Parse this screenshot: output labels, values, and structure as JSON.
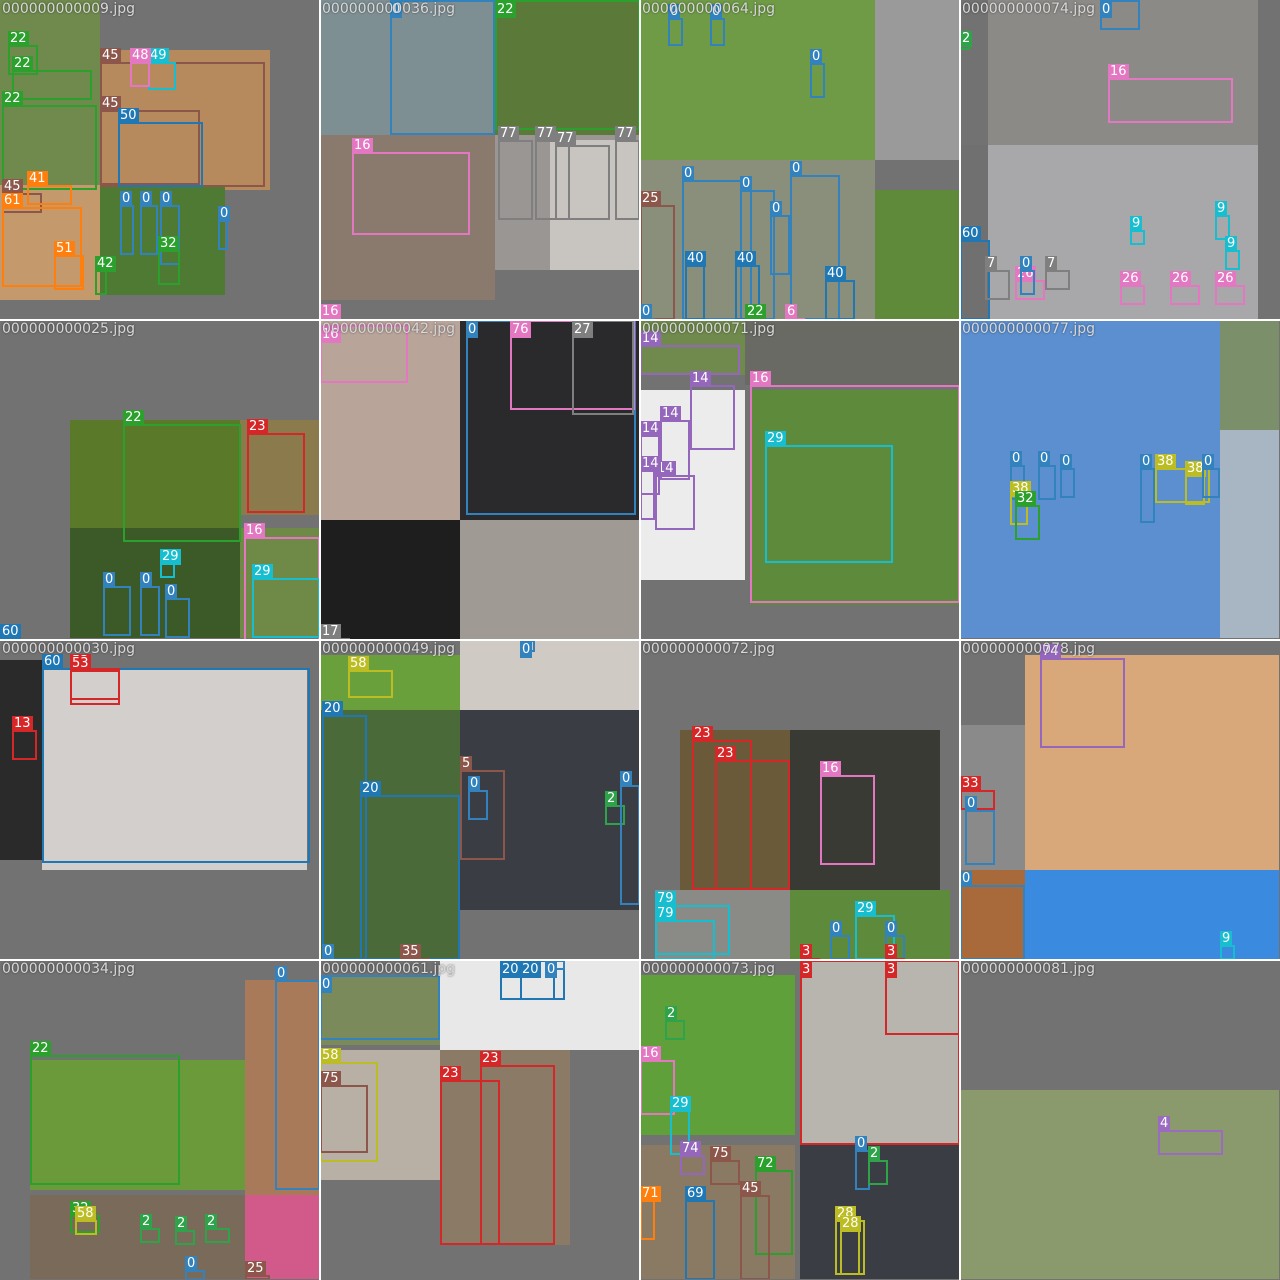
{
  "title": "",
  "class_colors": {
    "0": "#3283bd",
    "2": "#2ea34a",
    "3": "#d62728",
    "4": "#9b6bc2",
    "5": "#8c564b",
    "6": "#e377c2",
    "7": "#7f7f7f",
    "9": "#17becf",
    "13": "#d62728",
    "14": "#9467bd",
    "16": "#e377c2",
    "17": "#7f7f7f",
    "20": "#1f77b4",
    "22": "#2ca02c",
    "23": "#d62728",
    "25": "#8c564b",
    "26": "#e377c2",
    "27": "#7f7f7f",
    "28": "#bcbd22",
    "29": "#17becf",
    "32": "#2ca02c",
    "33": "#d62728",
    "35": "#8c564b",
    "38": "#bcbd22",
    "40": "#1f77b4",
    "41": "#ff7f0e",
    "42": "#2ca02c",
    "45": "#8c564b",
    "48": "#e377c2",
    "49": "#17becf",
    "50": "#1f77b4",
    "51": "#ff7f0e",
    "53": "#d62728",
    "58": "#bcbd22",
    "60": "#1f77b4",
    "61": "#ff7f0e",
    "69": "#1f77b4",
    "71": "#ff7f0e",
    "72": "#2ca02c",
    "74": "#9467bd",
    "75": "#8c564b",
    "76": "#e377c2",
    "77": "#7f7f7f",
    "79": "#17becf"
  },
  "tiles": [
    {
      "name": "000000000009.jpg",
      "photos": [
        {
          "color": "#6f8a4c"
        },
        {
          "color": "#b68a5c"
        },
        {
          "color": "#c49a6c"
        },
        {
          "color": "#4e7a34"
        }
      ],
      "boxes": [
        {
          "cls": "22"
        },
        {
          "cls": "22"
        },
        {
          "cls": "22"
        },
        {
          "cls": "45"
        },
        {
          "cls": "49"
        },
        {
          "cls": "48"
        },
        {
          "cls": "45"
        },
        {
          "cls": "50"
        },
        {
          "cls": "45"
        },
        {
          "cls": "41"
        },
        {
          "cls": "61"
        },
        {
          "cls": "51"
        },
        {
          "cls": "0"
        },
        {
          "cls": "0"
        },
        {
          "cls": "0"
        },
        {
          "cls": "32"
        },
        {
          "cls": "42"
        },
        {
          "cls": "0"
        }
      ]
    },
    {
      "name": "000000000036.jpg",
      "photos": [
        {
          "color": "#7e8f94"
        },
        {
          "color": "#5b7a3a"
        },
        {
          "color": "#8a7a6e"
        },
        {
          "color": "#9a9694"
        },
        {
          "color": "#c8c4c0"
        }
      ],
      "boxes": [
        {
          "cls": "0"
        },
        {
          "cls": "22"
        },
        {
          "cls": "16"
        },
        {
          "cls": "77"
        },
        {
          "cls": "77"
        },
        {
          "cls": "77"
        },
        {
          "cls": "77"
        },
        {
          "cls": "16"
        }
      ]
    },
    {
      "name": "000000000064.jpg",
      "photos": [
        {
          "color": "#6f9b47"
        },
        {
          "color": "#9a9a9a"
        },
        {
          "color": "#8a8f7c"
        },
        {
          "color": "#5f8a3a"
        }
      ],
      "boxes": [
        {
          "cls": "0"
        },
        {
          "cls": "0"
        },
        {
          "cls": "0"
        },
        {
          "cls": "25"
        },
        {
          "cls": "0"
        },
        {
          "cls": "0"
        },
        {
          "cls": "0"
        },
        {
          "cls": "0"
        },
        {
          "cls": "40"
        },
        {
          "cls": "40"
        },
        {
          "cls": "40"
        },
        {
          "cls": "22"
        },
        {
          "cls": "6"
        },
        {
          "cls": "0"
        }
      ]
    },
    {
      "name": "000000000074.jpg",
      "photos": [
        {
          "color": "#8c8a86"
        },
        {
          "color": "#a8a8aa"
        },
        {
          "color": "#707070"
        }
      ],
      "boxes": [
        {
          "cls": "2"
        },
        {
          "cls": "16"
        },
        {
          "cls": "0"
        },
        {
          "cls": "60"
        },
        {
          "cls": "7"
        },
        {
          "cls": "7"
        },
        {
          "cls": "9"
        },
        {
          "cls": "9"
        },
        {
          "cls": "26"
        },
        {
          "cls": "26"
        },
        {
          "cls": "26"
        },
        {
          "cls": "26"
        },
        {
          "cls": "0"
        },
        {
          "cls": "9"
        }
      ]
    },
    {
      "name": "000000000025.jpg",
      "photos": [
        {
          "color": "#5a7a2a"
        },
        {
          "color": "#8a7a4c"
        },
        {
          "color": "#3c5a28"
        },
        {
          "color": "#6e8a46"
        }
      ],
      "boxes": [
        {
          "cls": "22"
        },
        {
          "cls": "23"
        },
        {
          "cls": "16"
        },
        {
          "cls": "29"
        },
        {
          "cls": "29"
        },
        {
          "cls": "0"
        },
        {
          "cls": "0"
        },
        {
          "cls": "0"
        },
        {
          "cls": "60"
        }
      ]
    },
    {
      "name": "000000000042.jpg",
      "photos": [
        {
          "color": "#b9a49a"
        },
        {
          "color": "#2a2a2c"
        },
        {
          "color": "#1e1e1e"
        },
        {
          "color": "#a09a94"
        }
      ],
      "boxes": [
        {
          "cls": "16"
        },
        {
          "cls": "0"
        },
        {
          "cls": "76"
        },
        {
          "cls": "27"
        },
        {
          "cls": "17"
        }
      ]
    },
    {
      "name": "000000000071.jpg",
      "photos": [
        {
          "color": "#6f8a4c"
        },
        {
          "color": "#6a6a64"
        },
        {
          "color": "#ececec"
        },
        {
          "color": "#5e8a3c"
        }
      ],
      "boxes": [
        {
          "cls": "14"
        },
        {
          "cls": "14"
        },
        {
          "cls": "14"
        },
        {
          "cls": "14"
        },
        {
          "cls": "14"
        },
        {
          "cls": "14"
        },
        {
          "cls": "16"
        },
        {
          "cls": "29"
        }
      ]
    },
    {
      "name": "000000000077.jpg",
      "photos": [
        {
          "color": "#5b8fd0"
        },
        {
          "color": "#7a8f6a"
        },
        {
          "color": "#a8b6c4"
        }
      ],
      "boxes": [
        {
          "cls": "0"
        },
        {
          "cls": "0"
        },
        {
          "cls": "0"
        },
        {
          "cls": "38"
        },
        {
          "cls": "38"
        },
        {
          "cls": "32"
        },
        {
          "cls": "0"
        },
        {
          "cls": "38"
        },
        {
          "cls": "0"
        }
      ]
    },
    {
      "name": "000000000030.jpg",
      "photos": [
        {
          "color": "#2a2a2a"
        },
        {
          "color": "#d2cfcc"
        }
      ],
      "boxes": [
        {
          "cls": "60"
        },
        {
          "cls": "53"
        },
        {
          "cls": "13"
        },
        {
          "cls": "53"
        }
      ]
    },
    {
      "name": "000000000049.jpg",
      "photos": [
        {
          "color": "#6aa03c"
        },
        {
          "color": "#cfcac4"
        },
        {
          "color": "#4a6a3a"
        },
        {
          "color": "#3a3e44"
        }
      ],
      "boxes": [
        {
          "cls": "58"
        },
        {
          "cls": "20"
        },
        {
          "cls": "20"
        },
        {
          "cls": "5"
        },
        {
          "cls": "0"
        },
        {
          "cls": "2"
        },
        {
          "cls": "0"
        },
        {
          "cls": "0"
        },
        {
          "cls": "35"
        },
        {
          "cls": "0"
        }
      ]
    },
    {
      "name": "000000000072.jpg",
      "photos": [
        {
          "color": "#6a5a3a"
        },
        {
          "color": "#3a3a34"
        },
        {
          "color": "#8a8a86"
        },
        {
          "color": "#5e8a3c"
        }
      ],
      "boxes": [
        {
          "cls": "23"
        },
        {
          "cls": "23"
        },
        {
          "cls": "16"
        },
        {
          "cls": "79"
        },
        {
          "cls": "79"
        },
        {
          "cls": "29"
        },
        {
          "cls": "0"
        },
        {
          "cls": "0"
        },
        {
          "cls": "3"
        },
        {
          "cls": "3"
        }
      ]
    },
    {
      "name": "000000000078.jpg",
      "photos": [
        {
          "color": "#8a8a8a"
        },
        {
          "color": "#d9a87a"
        },
        {
          "color": "#a86a3a"
        },
        {
          "color": "#3a8ae0"
        }
      ],
      "boxes": [
        {
          "cls": "74"
        },
        {
          "cls": "33"
        },
        {
          "cls": "0"
        },
        {
          "cls": "0"
        },
        {
          "cls": "9"
        }
      ]
    },
    {
      "name": "000000000034.jpg",
      "photos": [
        {
          "color": "#6a9a3a"
        },
        {
          "color": "#a87a5a"
        },
        {
          "color": "#7a6a5a"
        },
        {
          "color": "#d25a8a"
        }
      ],
      "boxes": [
        {
          "cls": "22"
        },
        {
          "cls": "0"
        },
        {
          "cls": "32"
        },
        {
          "cls": "58"
        },
        {
          "cls": "2"
        },
        {
          "cls": "2"
        },
        {
          "cls": "2"
        },
        {
          "cls": "0"
        },
        {
          "cls": "25"
        }
      ]
    },
    {
      "name": "000000000061.jpg",
      "photos": [
        {
          "color": "#7a8a5a"
        },
        {
          "color": "#e8e8e8"
        },
        {
          "color": "#b8b0a4"
        },
        {
          "color": "#8a7a66"
        }
      ],
      "boxes": [
        {
          "cls": "0"
        },
        {
          "cls": "20"
        },
        {
          "cls": "20"
        },
        {
          "cls": "0"
        },
        {
          "cls": "58"
        },
        {
          "cls": "75"
        },
        {
          "cls": "23"
        },
        {
          "cls": "23"
        }
      ]
    },
    {
      "name": "000000000073.jpg",
      "photos": [
        {
          "color": "#5fa03a"
        },
        {
          "color": "#b8b4ae"
        },
        {
          "color": "#8a7a64"
        },
        {
          "color": "#3a3e44"
        }
      ],
      "boxes": [
        {
          "cls": "2"
        },
        {
          "cls": "16"
        },
        {
          "cls": "29"
        },
        {
          "cls": "74"
        },
        {
          "cls": "75"
        },
        {
          "cls": "72"
        },
        {
          "cls": "71"
        },
        {
          "cls": "69"
        },
        {
          "cls": "45"
        },
        {
          "cls": "3"
        },
        {
          "cls": "3"
        },
        {
          "cls": "0"
        },
        {
          "cls": "2"
        },
        {
          "cls": "28"
        },
        {
          "cls": "28"
        }
      ]
    },
    {
      "name": "000000000081.jpg",
      "photos": [
        {
          "color": "#8a9a6c"
        }
      ],
      "boxes": [
        {
          "cls": "4"
        }
      ]
    }
  ]
}
